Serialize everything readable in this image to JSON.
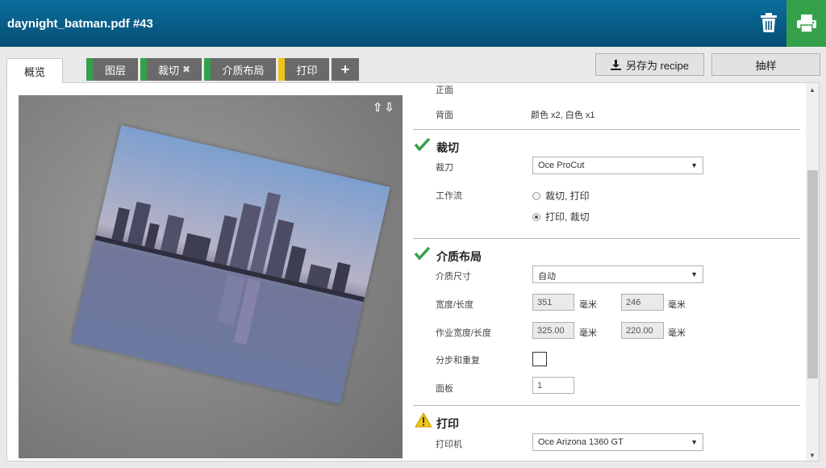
{
  "header": {
    "title": "daynight_batman.pdf #43"
  },
  "tabs": [
    {
      "label": "概览"
    },
    {
      "label": "图层"
    },
    {
      "label": "裁切"
    },
    {
      "label": "介质布局"
    },
    {
      "label": "打印"
    },
    {
      "label": "+"
    }
  ],
  "cut_tab_close": "✖",
  "toolbar": {
    "save_recipe": "另存为 recipe",
    "sample": "抽样"
  },
  "preview": {
    "arrows": "⇧⇩"
  },
  "colors": {
    "header": "#0a6e9c",
    "print_button": "#35a04a",
    "ok": "#35a04a",
    "warn": "#f0c419",
    "tab": "#6a6a6a"
  },
  "layers": {
    "front_label": "正面",
    "back_label": "背面",
    "back_value": "颜色 x2, 白色 x1"
  },
  "cut": {
    "title": "裁切",
    "cutter_label": "裁刀",
    "cutter_value": "Oce ProCut",
    "workflow_label": "工作流",
    "workflow_option1": "裁切, 打印",
    "workflow_option2": "打印, 裁切",
    "workflow_selected": 2
  },
  "media": {
    "title": "介质布局",
    "size_label": "介质尺寸",
    "size_value": "自动",
    "wl_label": "宽度/长度",
    "width": "351",
    "length": "246",
    "unit": "毫米",
    "work_label": "作业宽度/长度",
    "work_width": "325.00",
    "work_length": "220.00",
    "step_label": "分步和重复",
    "panels_label": "面板",
    "panels_value": "1"
  },
  "print": {
    "title": "打印",
    "printer_label": "打印机",
    "printer_value": "Oce Arizona 1360 GT"
  }
}
